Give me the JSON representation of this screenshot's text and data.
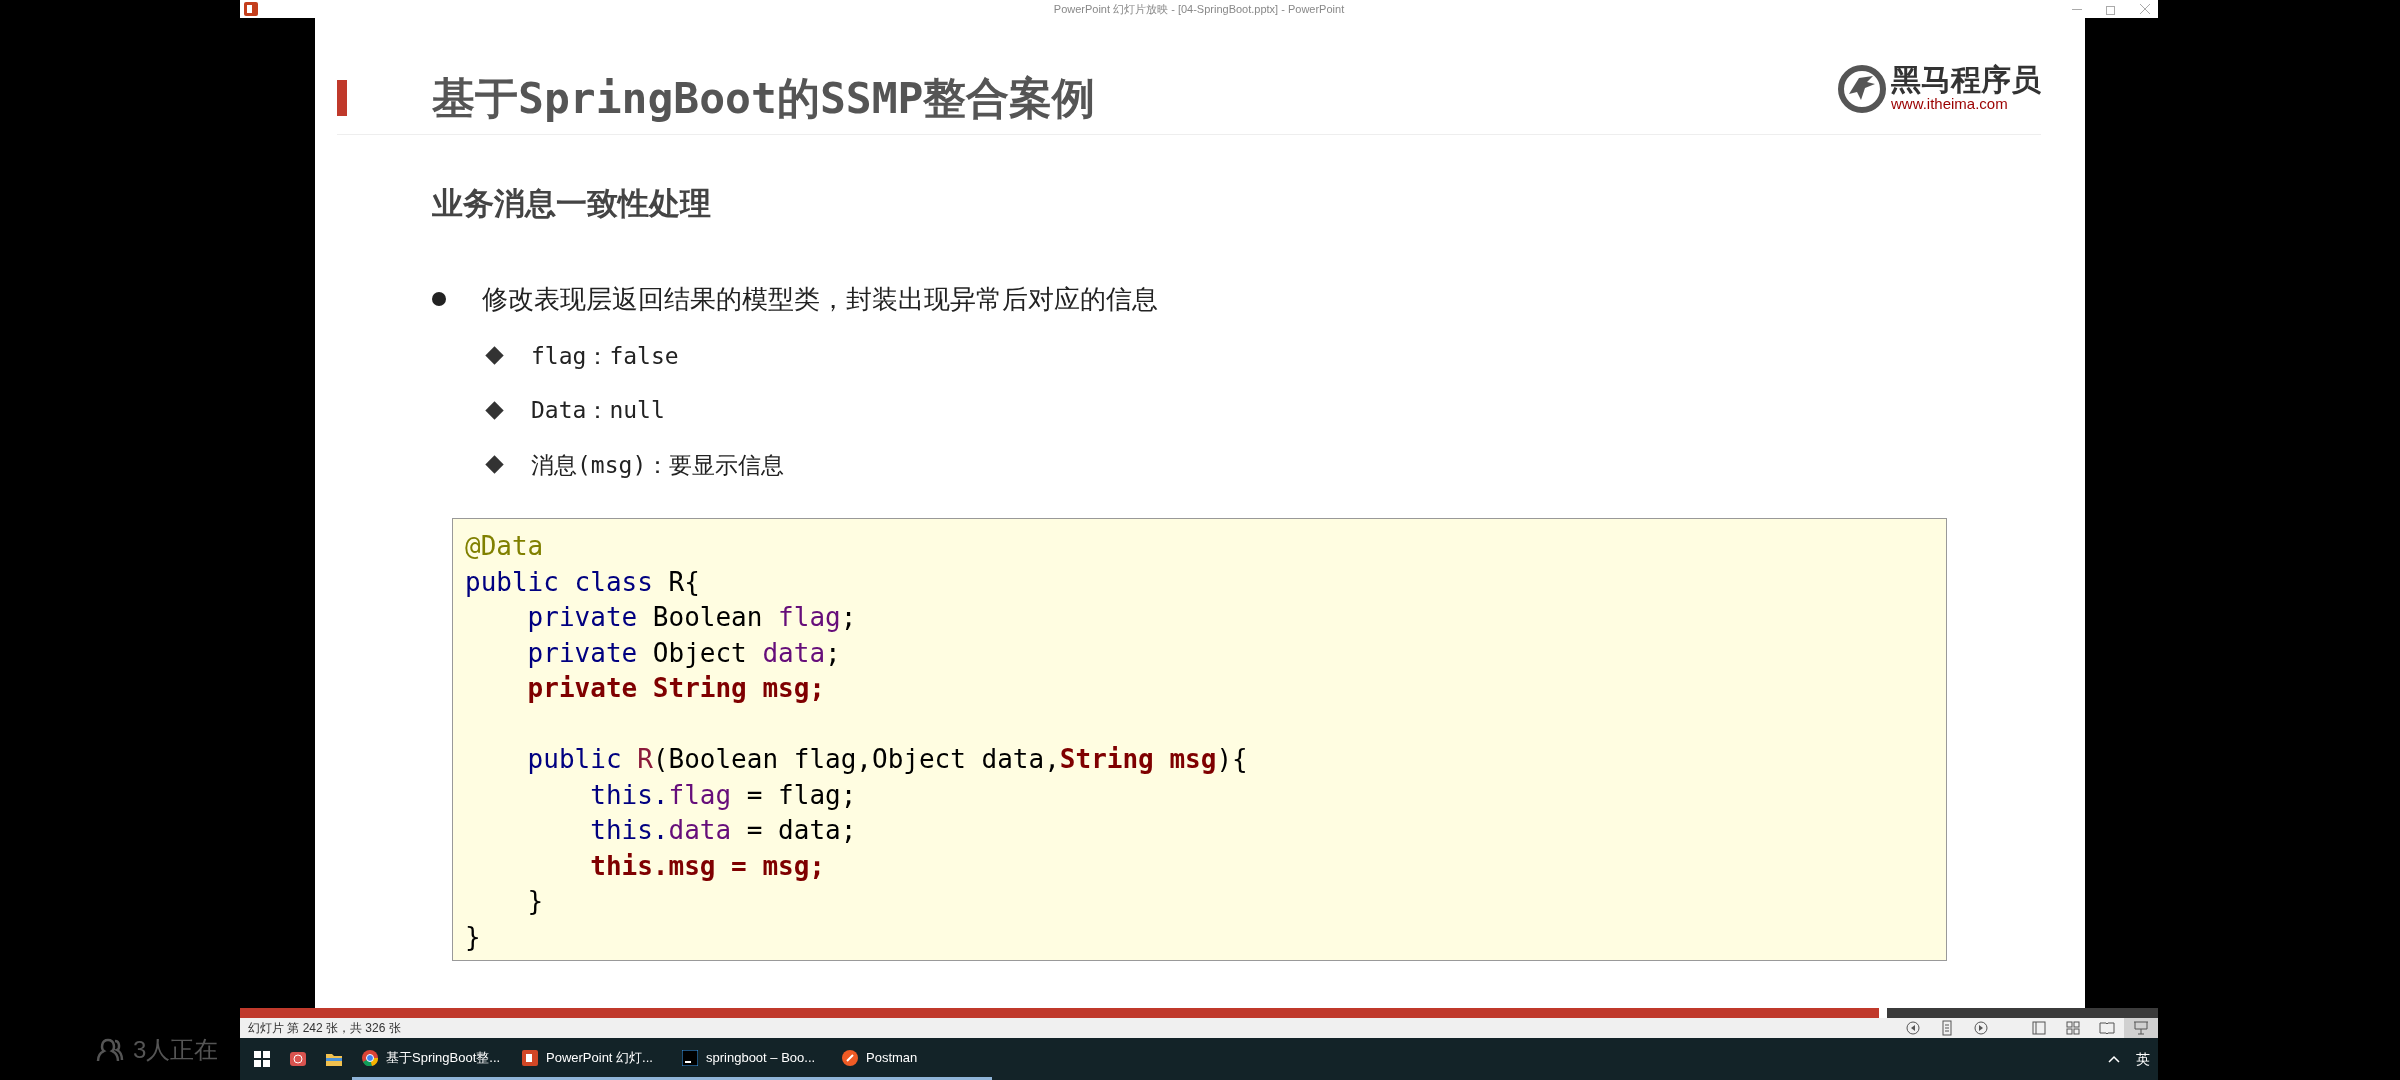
{
  "window": {
    "title": "PowerPoint 幻灯片放映 - [04-SpringBoot.pptx] - PowerPoint"
  },
  "slide": {
    "title": "基于SpringBoot的SSMP整合案例",
    "brand": {
      "name": "黑马程序员",
      "url": "www.itheima.com"
    },
    "subtitle": "业务消息一致性处理",
    "bullets": [
      {
        "text": "修改表现层返回结果的模型类，封装出现异常后对应的信息",
        "children": [
          {
            "text": "flag：false"
          },
          {
            "text": "Data：null"
          },
          {
            "text": "消息(msg)：要显示信息"
          }
        ]
      }
    ],
    "code": [
      {
        "tokens": [
          {
            "kind": "annotation",
            "text": "@Data"
          }
        ]
      },
      {
        "tokens": [
          {
            "kind": "keyword",
            "text": "public class"
          },
          {
            "kind": "plain",
            "text": " R{"
          }
        ]
      },
      {
        "tokens": [
          {
            "kind": "keyword",
            "text": "    private"
          },
          {
            "kind": "plain",
            "text": " Boolean "
          },
          {
            "kind": "field",
            "text": "flag"
          },
          {
            "kind": "plain",
            "text": ";"
          }
        ]
      },
      {
        "tokens": [
          {
            "kind": "keyword",
            "text": "    private"
          },
          {
            "kind": "plain",
            "text": " Object "
          },
          {
            "kind": "field",
            "text": "data"
          },
          {
            "kind": "plain",
            "text": ";"
          }
        ]
      },
      {
        "tokens": [
          {
            "kind": "highlight",
            "text": "    private String msg;"
          }
        ]
      },
      {
        "kind": "blank"
      },
      {
        "tokens": [
          {
            "kind": "keyword",
            "text": "    public "
          },
          {
            "kind": "method",
            "text": "R"
          },
          {
            "kind": "plain",
            "text": "(Boolean flag,Object data,"
          },
          {
            "kind": "highlight",
            "text": "String msg"
          },
          {
            "kind": "plain",
            "text": "){"
          }
        ]
      },
      {
        "tokens": [
          {
            "kind": "keyword",
            "text": "        this."
          },
          {
            "kind": "field",
            "text": "flag"
          },
          {
            "kind": "plain",
            "text": " = flag;"
          }
        ]
      },
      {
        "tokens": [
          {
            "kind": "keyword",
            "text": "        this."
          },
          {
            "kind": "field",
            "text": "data"
          },
          {
            "kind": "plain",
            "text": " = data;"
          }
        ]
      },
      {
        "tokens": [
          {
            "kind": "highlight",
            "text": "        this.msg = msg;"
          }
        ]
      },
      {
        "tokens": [
          {
            "kind": "plain",
            "text": "    }"
          }
        ]
      },
      {
        "tokens": [
          {
            "kind": "plain",
            "text": "}"
          }
        ]
      }
    ]
  },
  "progress": {
    "level": 0.858
  },
  "status_bar": {
    "text": "幻灯片 第 242 张，共 326 张",
    "views": [
      {
        "kind": "reading",
        "selected": false
      },
      {
        "kind": "sorter",
        "selected": false
      },
      {
        "kind": "book",
        "selected": false
      },
      {
        "kind": "slideshow",
        "selected": true
      }
    ]
  },
  "taskbar": {
    "items": [
      {
        "kind": "start"
      },
      {
        "kind": "app"
      },
      {
        "kind": "folder"
      },
      {
        "kind": "chrome",
        "label": "基于SpringBoot整..."
      },
      {
        "kind": "powerpoint",
        "label": "PowerPoint 幻灯..."
      },
      {
        "kind": "intellij",
        "label": "springboot – Boo..."
      },
      {
        "kind": "postman",
        "label": "Postman"
      }
    ],
    "tray": {
      "input_method": "英"
    }
  },
  "viewers": {
    "text": "3人正在"
  }
}
